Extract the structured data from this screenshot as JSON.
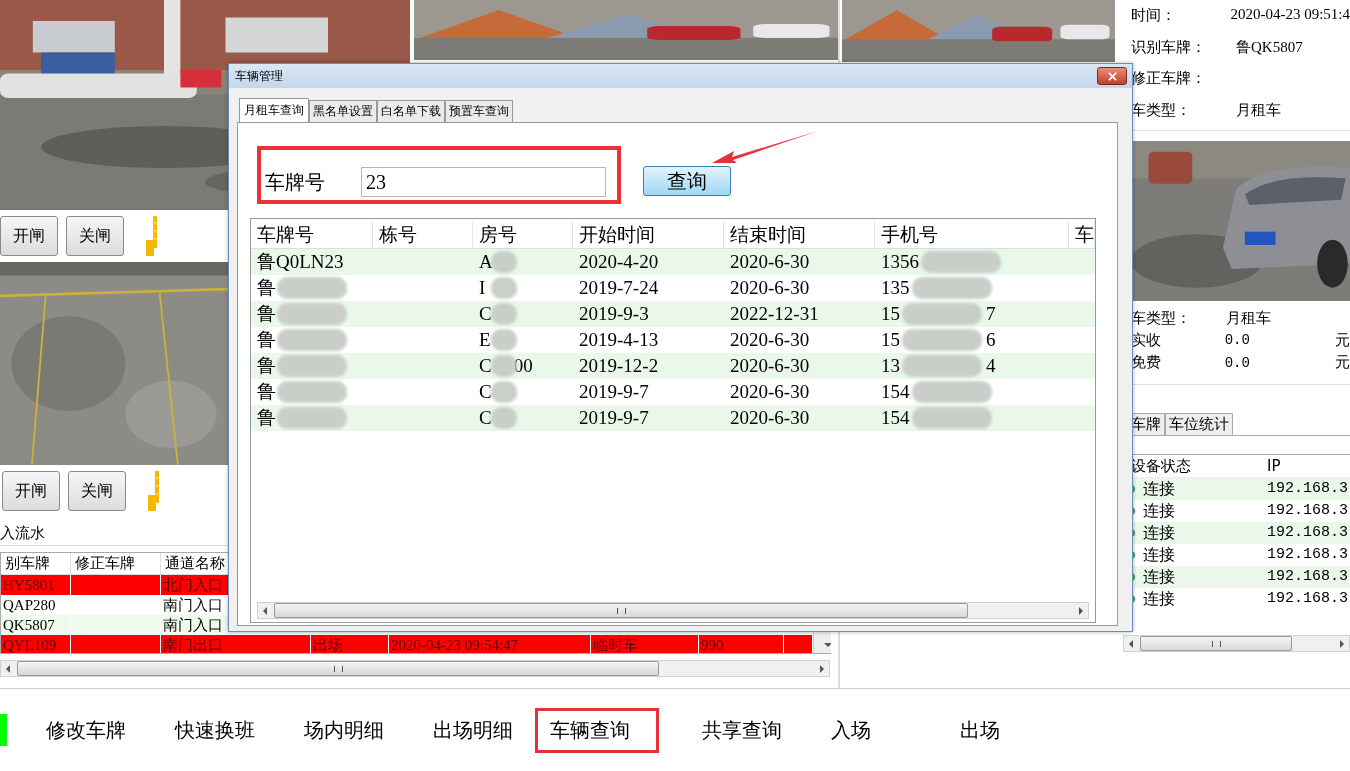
{
  "left_panel": {
    "gate_controls": [
      {
        "buttons": [
          "开闸",
          "关闸"
        ]
      },
      {
        "buttons": [
          "开闸",
          "关闸"
        ]
      }
    ],
    "records": {
      "title": "入流水",
      "columns": [
        "别车牌",
        "修正车牌",
        "通道名称"
      ],
      "rows": [
        {
          "flagged": true,
          "column_1": "HY5801",
          "column_3": "北门入口"
        },
        {
          "flagged": false,
          "column_1": "QAP280",
          "column_3": "南门入口"
        },
        {
          "flagged": false,
          "column_1": "QK5807",
          "column_3": "南门入口"
        },
        {
          "flagged": true,
          "column_1": "QYL109",
          "column_3": "南门出口",
          "column_4": "出场",
          "column_5": "2020-04-23 09:54:47",
          "column_6": "临时车",
          "column_7": "990"
        }
      ]
    }
  },
  "right_panel": {
    "info": [
      {
        "label": "时间：",
        "value": "2020-04-23 09:51:4"
      },
      {
        "label": "识别车牌：",
        "value": "鲁QK5807"
      },
      {
        "label": "修正车牌："
      },
      {
        "label": "车类型：",
        "value": "月租车"
      }
    ],
    "fees": {
      "type_label": "车类型：",
      "type_value": "月租车",
      "rows": [
        {
          "label": "实收",
          "amount": "0.0",
          "unit": "元"
        },
        {
          "label": "免费",
          "amount": "0.0",
          "unit": "元"
        }
      ]
    },
    "tabs": [
      {
        "label": "车牌",
        "selected": false
      },
      {
        "label": "车位统计",
        "selected": false
      }
    ],
    "devices": {
      "columns": [
        "设备状态",
        "IP"
      ],
      "rows": [
        {
          "status": "连接",
          "ip": "192.168.3",
          "connected": true
        },
        {
          "status": "连接",
          "ip": "192.168.3",
          "connected": true
        },
        {
          "status": "连接",
          "ip": "192.168.3",
          "connected": true
        },
        {
          "status": "连接",
          "ip": "192.168.3",
          "connected": true
        },
        {
          "status": "连接",
          "ip": "192.168.3",
          "connected": true
        },
        {
          "status": "连接",
          "ip": "192.168.3",
          "connected": true
        }
      ]
    }
  },
  "dialog": {
    "title": "车辆管理",
    "tabs": [
      {
        "label": "月租车查询",
        "selected": true
      },
      {
        "label": "黑名单设置",
        "selected": false
      },
      {
        "label": "白名单下载",
        "selected": false
      },
      {
        "label": "预置车查询",
        "selected": false
      }
    ],
    "search": {
      "label": "车牌号",
      "value": "23",
      "button": "查询"
    },
    "table": {
      "columns": [
        "车牌号",
        "栋号",
        "房号",
        "开始时间",
        "结束时间",
        "手机号",
        "车"
      ],
      "rows": [
        {
          "plate": "鲁Q0LN23",
          "blur_plate": false,
          "room": "A",
          "start": "2020-4-20",
          "end": "2020-6-30",
          "phone": "1356"
        },
        {
          "plate": "鲁",
          "blur_plate": true,
          "room": "I",
          "start": "2019-7-24",
          "end": "2020-6-30",
          "phone": "135"
        },
        {
          "plate": "鲁",
          "blur_plate": true,
          "room": "C",
          "start": "2019-9-3",
          "end": "2022-12-31",
          "phone": "15",
          "phone_end": "7"
        },
        {
          "plate": "鲁",
          "blur_plate": true,
          "room": "E",
          "start": "2019-4-13",
          "end": "2020-6-30",
          "phone": "15",
          "phone_end": "6"
        },
        {
          "plate": "鲁",
          "blur_plate": true,
          "room": "C",
          "room_end": "00",
          "start": "2019-12-2",
          "end": "2020-6-30",
          "phone": "13",
          "phone_end": "4"
        },
        {
          "plate": "鲁",
          "blur_plate": true,
          "room": "C",
          "start": "2019-9-7",
          "end": "2020-6-30",
          "phone": "154"
        },
        {
          "plate": "鲁",
          "blur_plate": true,
          "room": "C",
          "start": "2019-9-7",
          "end": "2020-6-30",
          "phone": "154"
        }
      ]
    }
  },
  "bottom_nav": [
    {
      "label": "修改车牌",
      "selected": false
    },
    {
      "label": "快速换班",
      "selected": false
    },
    {
      "label": "场内明细",
      "selected": false
    },
    {
      "label": "出场明细",
      "selected": false
    },
    {
      "label": "车辆查询",
      "selected": true
    },
    {
      "label": "共享查询",
      "selected": false
    },
    {
      "label": "入场",
      "selected": false
    },
    {
      "label": "出场",
      "selected": false
    }
  ]
}
